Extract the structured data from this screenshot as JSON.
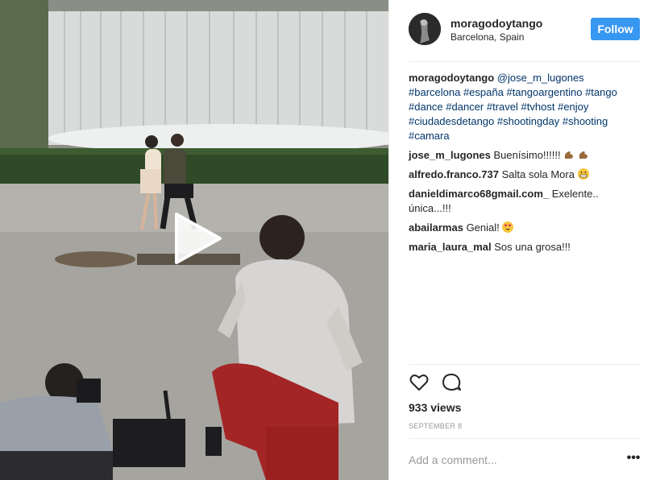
{
  "post": {
    "username": "moragodoytango",
    "location": "Barcelona, Spain",
    "follow_label": "Follow",
    "accent_color": "#3897f0"
  },
  "caption": {
    "username": "moragodoytango",
    "mention": "@jose_m_lugones",
    "hashtags": [
      "#barcelona",
      "#españa",
      "#tangoargentino",
      "#tango",
      "#dance",
      "#dancer",
      "#travel",
      "#tvhost",
      "#enjoy",
      "#ciudadesdetango",
      "#shootingday",
      "#shooting",
      "#camara"
    ]
  },
  "comments": [
    {
      "username": "jose_m_lugones",
      "text": "Buenísimo!!!!!!",
      "emoji": "flexed-biceps-icon"
    },
    {
      "username": "alfredo.franco.737",
      "text": "Salta sola Mora",
      "emoji": "grinning-face-icon"
    },
    {
      "username": "danieldimarco68gmail.com_",
      "text": "Exelente.. única...!!!"
    },
    {
      "username": "abailarmas",
      "text": "Genial!",
      "emoji": "heart-eyes-face-icon"
    },
    {
      "username": "maria_laura_mal",
      "text": "Sos una grosa!!!"
    }
  ],
  "stats": {
    "views": "933 views",
    "date": "SEPTEMBER 8"
  },
  "composer": {
    "placeholder": "Add a comment...",
    "more_label": "•••"
  }
}
